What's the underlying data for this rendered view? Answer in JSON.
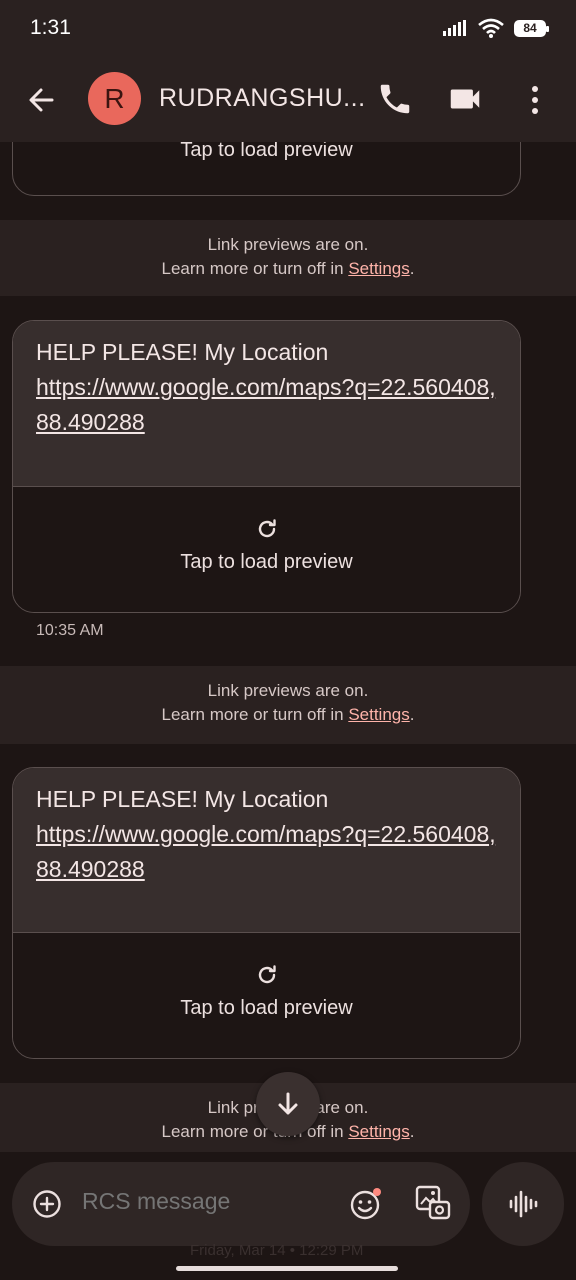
{
  "status_bar": {
    "time": "1:31",
    "battery": "84"
  },
  "app_bar": {
    "avatar_letter": "R",
    "contact_name": "RUDRANGSHU..."
  },
  "conversation": {
    "partial_preview_label": "Tap to load preview",
    "info_notices": [
      {
        "line1": "Link previews are on.",
        "line2_prefix": "Learn more or turn off in ",
        "link": "Settings",
        "suffix": "."
      },
      {
        "line1": "Link previews are on.",
        "line2_prefix": "Learn more or turn off in ",
        "link": "Settings",
        "suffix": "."
      },
      {
        "line1": "Link previews are on.",
        "line2_prefix": "Learn more or turn off in ",
        "link": "Settings",
        "suffix": "."
      }
    ],
    "messages": [
      {
        "text": "HELP PLEASE! My Location",
        "link": "https://www.google.com/maps?q=22.560408,88.490288",
        "preview_label": "Tap to load preview",
        "time": "10:35 AM"
      },
      {
        "text": "HELP PLEASE! My Location",
        "link": "https://www.google.com/maps?q=22.560408,88.490288",
        "preview_label": "Tap to load preview"
      }
    ]
  },
  "composer": {
    "placeholder": "RCS message",
    "ghost_date": "Friday, Mar 14 • 12:29 PM"
  },
  "colors": {
    "background": "#1d1514",
    "surface": "#2a2120",
    "bubble": "#372e2d",
    "accent_link": "#ffb4aa",
    "avatar": "#e9685c"
  }
}
